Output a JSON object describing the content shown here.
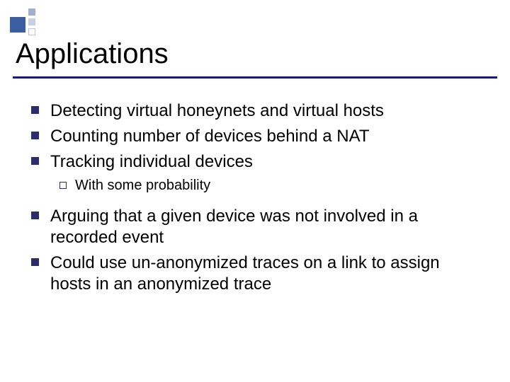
{
  "title": "Applications",
  "bullets": {
    "b1": "Detecting virtual honeynets and virtual hosts",
    "b2": "Counting number of devices behind a NAT",
    "b3": "Tracking individual devices",
    "b3_sub": "With some probability",
    "b4": "Arguing that a given device was not involved in a recorded event",
    "b5": "Could use un-anonymized traces on a link to assign hosts in an anonymized trace"
  }
}
